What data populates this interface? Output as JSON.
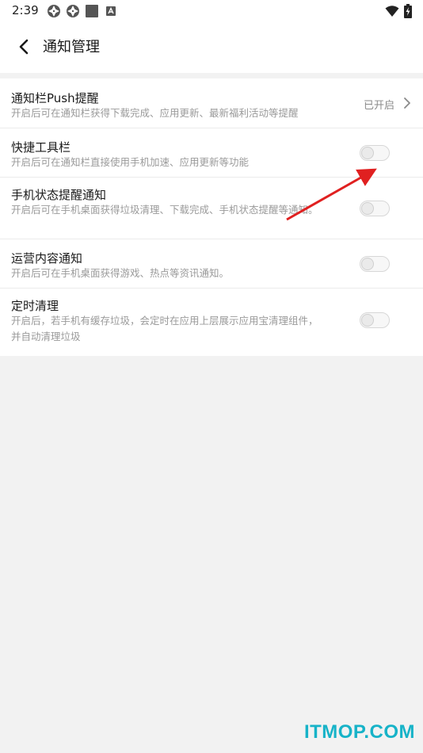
{
  "status_bar": {
    "time": "2:39",
    "notification_icons": [
      "shutter-icon",
      "shutter-icon",
      "square-icon",
      "font-a-icon"
    ],
    "wifi_icon": "wifi-icon",
    "battery_icon": "battery-charging-icon"
  },
  "header": {
    "back_icon": "chevron-left-icon",
    "title": "通知管理"
  },
  "settings": [
    {
      "title": "通知栏Push提醒",
      "description": "开启后可在通知栏获得下载完成、应用更新、最新福利活动等提醒",
      "status": "已开启",
      "control": "chevron"
    },
    {
      "title": "快捷工具栏",
      "description": "开启后可在通知栏直接使用手机加速、应用更新等功能",
      "control": "toggle",
      "enabled": false
    },
    {
      "title": "手机状态提醒通知",
      "description": "开启后可在手机桌面获得垃圾清理、下载完成、手机状态提醒等通知。",
      "control": "toggle",
      "enabled": false
    },
    {
      "title": "运营内容通知",
      "description": "开启后可在手机桌面获得游戏、热点等资讯通知。",
      "control": "toggle",
      "enabled": false
    },
    {
      "title": "定时清理",
      "description": "开启后，若手机有缓存垃圾，会定时在应用上层展示应用宝清理组件，并自动清理垃圾",
      "control": "toggle",
      "enabled": false
    }
  ],
  "annotation": {
    "arrow_color": "#e02020"
  },
  "watermark": "ITMOP.COM",
  "colors": {
    "background": "#f2f2f2",
    "surface": "#ffffff",
    "watermark": "#17b3c8"
  }
}
